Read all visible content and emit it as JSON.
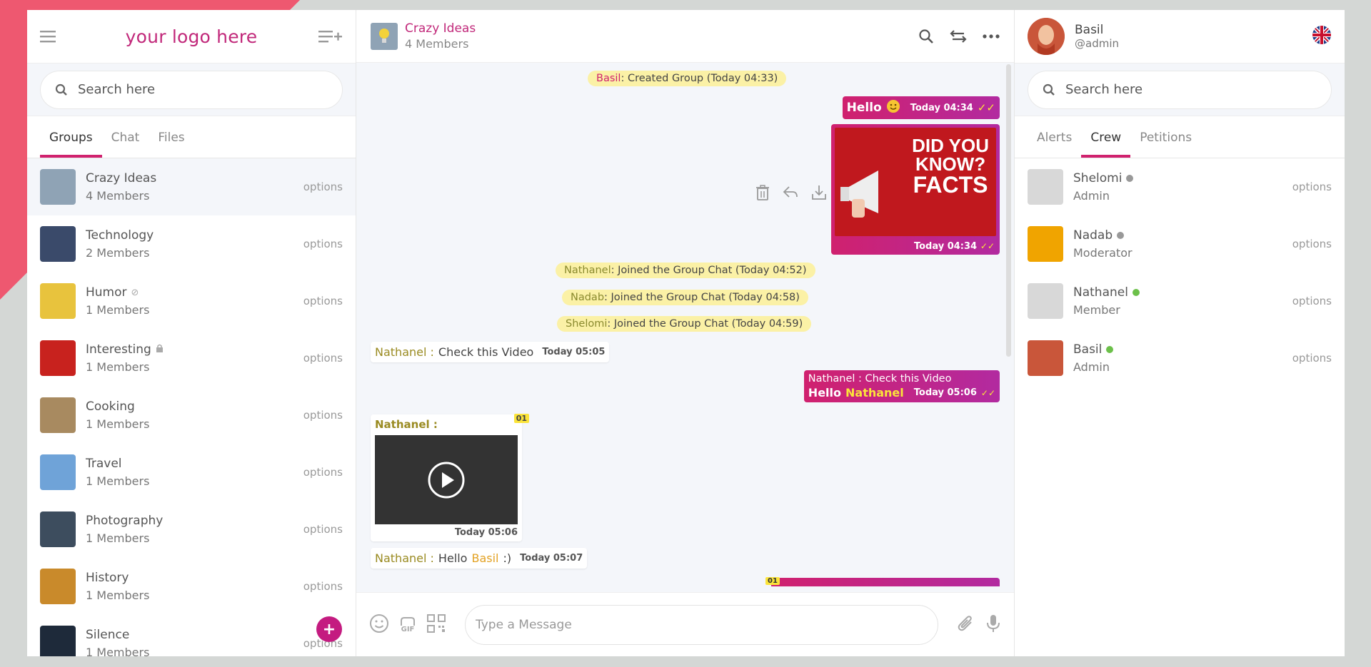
{
  "left": {
    "logo": "your logo here",
    "search_placeholder": "Search here",
    "tabs": [
      "Groups",
      "Chat",
      "Files"
    ],
    "groups": [
      {
        "name": "Crazy Ideas",
        "members": "4 Members",
        "option": "options",
        "color": "#8fa3b5"
      },
      {
        "name": "Technology",
        "members": "2 Members",
        "option": "options",
        "color": "#3a4a6a"
      },
      {
        "name": "Humor",
        "members": "1 Members",
        "option": "options",
        "color": "#e8c33d"
      },
      {
        "name": "Interesting",
        "members": "1 Members",
        "option": "options",
        "color": "#c8221e"
      },
      {
        "name": "Cooking",
        "members": "1 Members",
        "option": "options",
        "color": "#a88a60"
      },
      {
        "name": "Travel",
        "members": "1 Members",
        "option": "options",
        "color": "#6fa3d8"
      },
      {
        "name": "Photography",
        "members": "1 Members",
        "option": "options",
        "color": "#3d4d5e"
      },
      {
        "name": "History",
        "members": "1 Members",
        "option": "options",
        "color": "#c98a2b"
      },
      {
        "name": "Silence",
        "members": "1 Members",
        "option": "options",
        "color": "#1e2a3a"
      }
    ],
    "fab": "+"
  },
  "middle": {
    "title": "Crazy Ideas",
    "subtitle": "4 Members",
    "messages": {
      "sys1_name": "Basil",
      "sys1_text": ": Created Group (Today 04:33)",
      "hello_text": "Hello",
      "hello_time": "Today 04:34",
      "img_line1": "DID YOU",
      "img_line2": "KNOW?",
      "img_line3": "FACTS",
      "img_time": "Today 04:34",
      "sys2_name": "Nathanel",
      "sys2_text": ": Joined the Group Chat (Today 04:52)",
      "sys3_name": "Nadab",
      "sys3_text": ": Joined the Group Chat (Today 04:58)",
      "sys4_name": "Shelomi",
      "sys4_text": ": Joined the Group Chat (Today 04:59)",
      "in1_name": "Nathanel :",
      "in1_text": "Check this Video",
      "in1_time": "Today 05:05",
      "out2_quote": "Nathanel : Check this Video",
      "out2_text": "Hello",
      "out2_mention": "Nathanel",
      "out2_time": "Today 05:06",
      "in2_name": "Nathanel :",
      "in2_badge": "01",
      "in2_time": "Today 05:06",
      "in3_name": "Nathanel :",
      "in3_text": "Hello",
      "in3_mention": "Basil",
      "in3_suffix": ":)",
      "in3_time": "Today 05:07",
      "partial_badge": "01"
    },
    "input_placeholder": "Type a Message",
    "gif_label": "GIF"
  },
  "right": {
    "user_name": "Basil",
    "user_handle": "@admin",
    "search_placeholder": "Search here",
    "tabs": [
      "Alerts",
      "Crew",
      "Petitions"
    ],
    "crew": [
      {
        "name": "Shelomi",
        "role": "Admin",
        "option": "options",
        "status": "#999999",
        "avatar": "#d8d8d8"
      },
      {
        "name": "Nadab",
        "role": "Moderator",
        "option": "options",
        "status": "#999999",
        "avatar": "#f0a400"
      },
      {
        "name": "Nathanel",
        "role": "Member",
        "option": "options",
        "status": "#6cc04a",
        "avatar": "#d8d8d8"
      },
      {
        "name": "Basil",
        "role": "Admin",
        "option": "options",
        "status": "#6cc04a",
        "avatar": "#c9563a"
      }
    ]
  },
  "colors": {
    "accent": "#c1287a",
    "system_bubble": "#fbf1a6",
    "online": "#6cc04a",
    "offline": "#999999"
  }
}
